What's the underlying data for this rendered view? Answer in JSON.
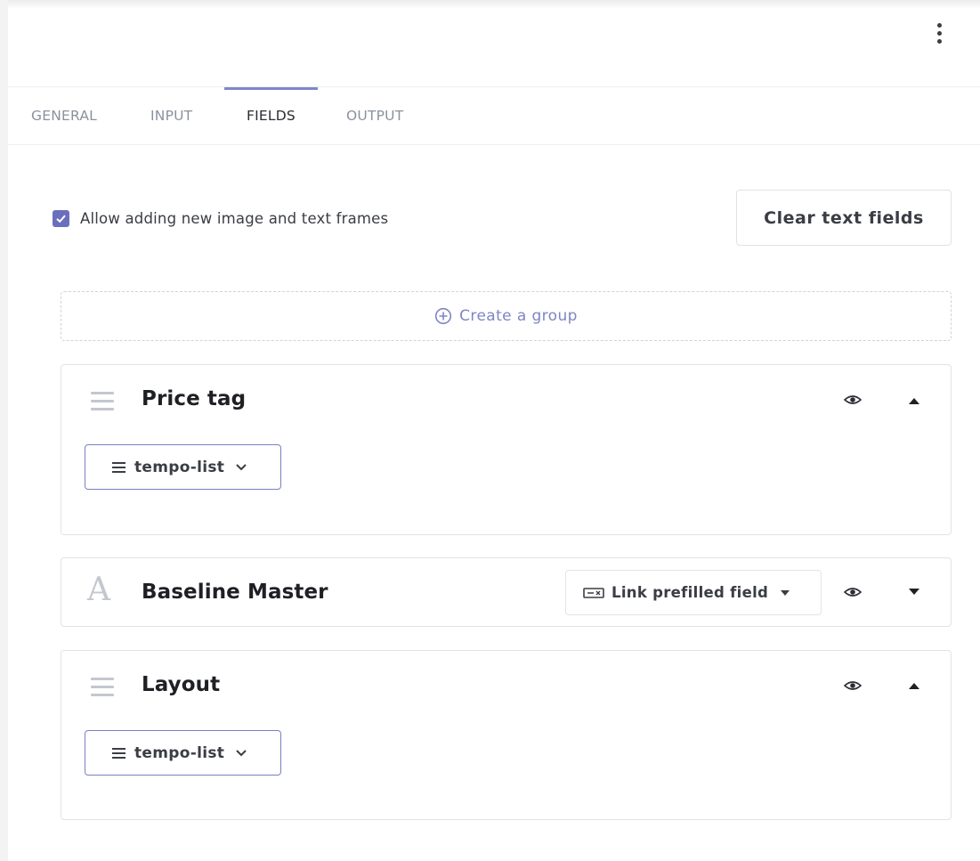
{
  "header": {
    "menu_icon": "kebab-vertical-icon"
  },
  "tabs": [
    {
      "label": "GENERAL",
      "active": false
    },
    {
      "label": "INPUT",
      "active": false
    },
    {
      "label": "FIELDS",
      "active": true
    },
    {
      "label": "OUTPUT",
      "active": false
    }
  ],
  "options": {
    "allow_frames_label": "Allow adding new image and text frames",
    "allow_frames_checked": true,
    "clear_button_label": "Clear text fields"
  },
  "create_group": {
    "label": "Create a group",
    "icon": "plus-circle-icon"
  },
  "cards": [
    {
      "title": "Price tag",
      "icon": "drag-handle-icon",
      "expanded": true,
      "select_label": "tempo-list"
    },
    {
      "title": "Baseline Master",
      "icon": "text-field-icon",
      "icon_glyph": "A",
      "expanded": false,
      "link_label": "Link prefilled field"
    },
    {
      "title": "Layout",
      "icon": "drag-handle-icon",
      "expanded": true,
      "select_label": "tempo-list"
    }
  ],
  "colors": {
    "accent": "#6a6fbd",
    "tab_active_bar": "#8087c7",
    "select_border": "#7a80c2",
    "muted_text": "#8a929c"
  }
}
